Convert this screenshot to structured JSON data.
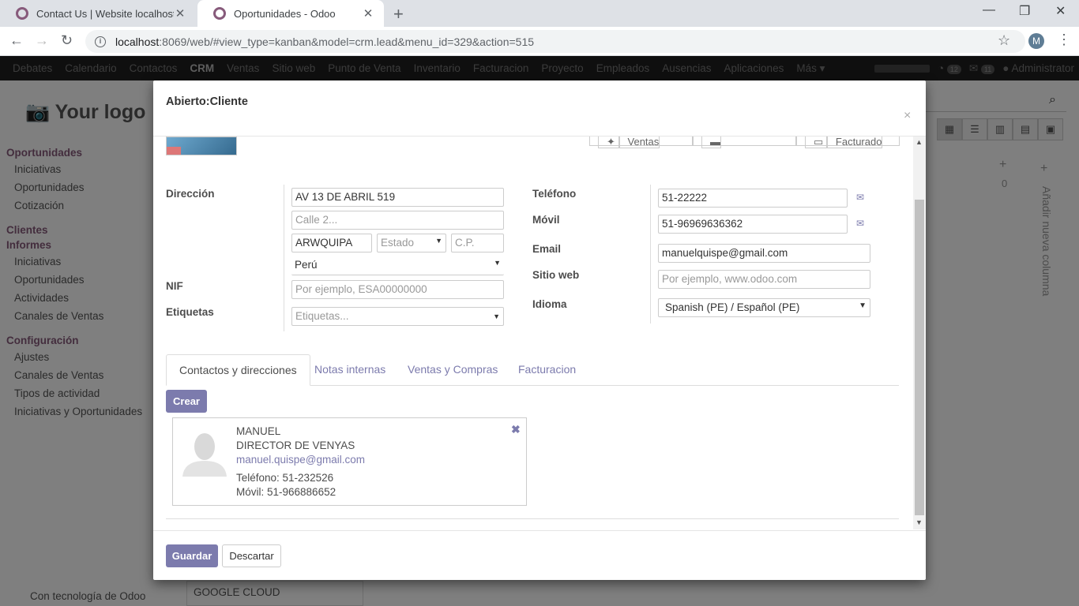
{
  "browser": {
    "tabs": [
      {
        "title": "Contact Us | Website localhost"
      },
      {
        "title": "Oportunidades - Odoo"
      }
    ],
    "url_host": "localhost",
    "url_path": ":8069/web/#view_type=kanban&model=crm.lead&menu_id=329&action=515",
    "profile_initial": "M"
  },
  "topnav": {
    "items": [
      "Debates",
      "Calendario",
      "Contactos",
      "CRM",
      "Ventas",
      "Sitio web",
      "Punto de Venta",
      "Inventario",
      "Facturacion",
      "Proyecto",
      "Empleados",
      "Ausencias",
      "Aplicaciones",
      "Más"
    ],
    "badge_1": "12",
    "badge_2": "11",
    "user": "Administrator"
  },
  "background": {
    "logo": "Your logo",
    "sidebar": [
      {
        "type": "h",
        "label": "Oportunidades"
      },
      {
        "type": "i",
        "label": "Iniciativas"
      },
      {
        "type": "i",
        "label": "Oportunidades"
      },
      {
        "type": "i",
        "label": "Cotización"
      },
      {
        "type": "h",
        "label": "Clientes"
      },
      {
        "type": "h",
        "label": "Informes"
      },
      {
        "type": "i",
        "label": "Iniciativas"
      },
      {
        "type": "i",
        "label": "Oportunidades"
      },
      {
        "type": "i",
        "label": "Actividades"
      },
      {
        "type": "i",
        "label": "Canales de Ventas"
      },
      {
        "type": "h",
        "label": "Configuración"
      },
      {
        "type": "i",
        "label": "Ajustes"
      },
      {
        "type": "i",
        "label": "Canales de Ventas"
      },
      {
        "type": "i",
        "label": "Tipos de actividad"
      },
      {
        "type": "i",
        "label": "Iniciativas y Oportunidades"
      }
    ],
    "powered": "Con tecnología de Odoo",
    "column_count": "0",
    "add_column": "Añadir nueva columna",
    "card_title": "GOOGLE CLOUD"
  },
  "modal": {
    "title": "Abierto:Cliente",
    "stat_buttons": [
      "Ventas",
      "",
      "Facturado"
    ],
    "labels": {
      "address": "Dirección",
      "nif": "NIF",
      "tags": "Etiquetas",
      "phone": "Teléfono",
      "mobile": "Móvil",
      "email": "Email",
      "website": "Sitio web",
      "language": "Idioma"
    },
    "fields": {
      "street": "AV 13 DE ABRIL 519",
      "street2_placeholder": "Calle 2...",
      "city": "ARWQUIPA",
      "state_placeholder": "Estado",
      "zip_placeholder": "C.P.",
      "country": "Perú",
      "nif_placeholder": "Por ejemplo, ESA00000000",
      "tags_placeholder": "Etiquetas...",
      "phone": "51-22222",
      "mobile": "51-96969636362",
      "email": "manuelquispe@gmail.com",
      "website_placeholder": "Por ejemplo, www.odoo.com",
      "language": "Spanish (PE) / Español (PE)"
    },
    "tabs": [
      "Contactos y direcciones",
      "Notas internas",
      "Ventas y Compras",
      "Facturacion"
    ],
    "create_button": "Crear",
    "contact": {
      "name": "MANUEL",
      "function": "DIRECTOR DE VENYAS",
      "email": "manuel.quispe@gmail.com",
      "phone": "Teléfono: 51-232526",
      "mobile": "Móvil: 51-966886652"
    },
    "save_button": "Guardar",
    "discard_button": "Descartar"
  }
}
